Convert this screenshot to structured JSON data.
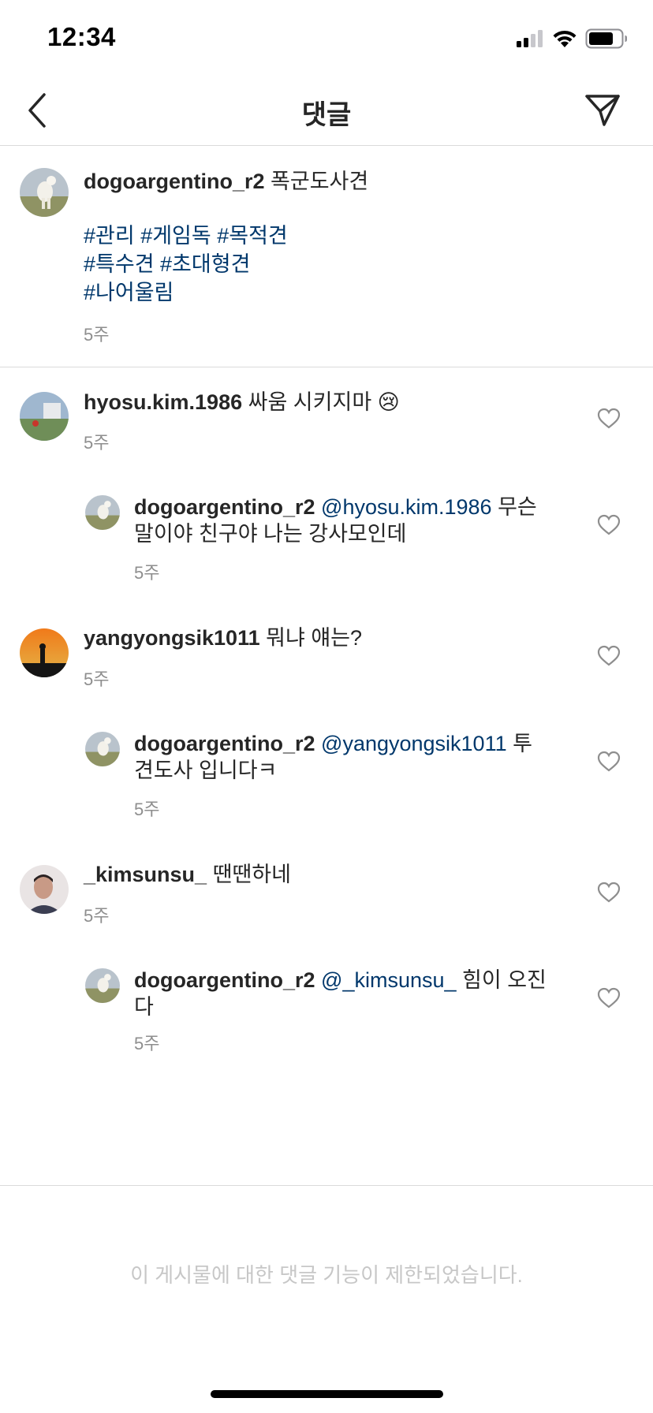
{
  "status_bar": {
    "time": "12:34"
  },
  "header": {
    "title": "댓글"
  },
  "caption": {
    "username": "dogoargentino_r2",
    "text": "폭군도사견",
    "hashtags": [
      "#관리 #게임독 #목적견",
      "#특수견 #초대형견",
      "#나어울림"
    ],
    "time": "5주"
  },
  "comments": [
    {
      "username": "hyosu.kim.1986",
      "text": "싸움 시키지마 😢",
      "time": "5주"
    },
    {
      "username": "dogoargentino_r2",
      "mention": "@hyosu.kim.1986",
      "text_line1": "무슨",
      "text_line2": "말이야 친구야 나는 강사모인데",
      "time": "5주"
    },
    {
      "username": "yangyongsik1011",
      "text": "뭐냐 얘는?",
      "time": "5주"
    },
    {
      "username": "dogoargentino_r2",
      "mention": "@yangyongsik1011",
      "text_line1": "투",
      "text_line2": "견도사 입니다ㅋ",
      "time": "5주"
    },
    {
      "username": "_kimsunsu_",
      "text": "땐땐하네",
      "time": "5주"
    },
    {
      "username": "dogoargentino_r2",
      "mention": "@_kimsunsu_",
      "text_line1": "힘이 오진",
      "text_line2": "다",
      "time": "5주"
    }
  ],
  "footer": {
    "notice": "이 게시물에 대한 댓글 기능이 제한되었습니다."
  },
  "icons": {
    "back": "chevron-left-icon",
    "send": "paper-plane-icon",
    "like": "heart-outline-icon",
    "signal": "cellular-signal-icon",
    "wifi": "wifi-icon",
    "battery": "battery-icon"
  },
  "colors": {
    "text": "#262626",
    "mention": "#00376b",
    "muted": "#8e8e8e",
    "divider": "#dbdbdb"
  }
}
